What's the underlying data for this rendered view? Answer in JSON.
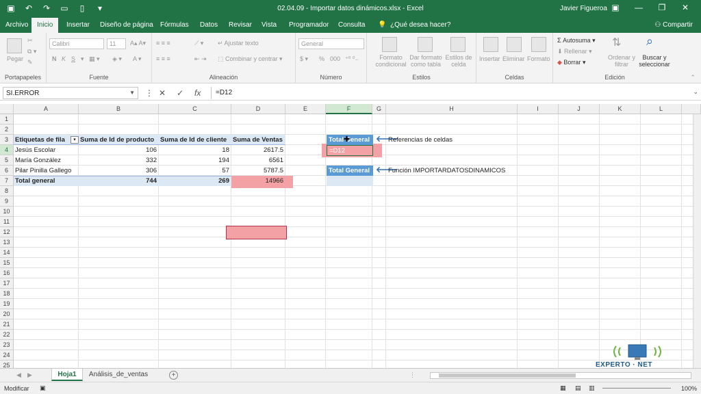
{
  "window": {
    "title": "02.04.09 - Importar datos dinámicos.xlsx - Excel",
    "user": "Javier Figueroa"
  },
  "ribbon_tabs": [
    "Archivo",
    "Inicio",
    "Insertar",
    "Diseño de página",
    "Fórmulas",
    "Datos",
    "Revisar",
    "Vista",
    "Programador",
    "Consulta",
    "¿Qué desea hacer?"
  ],
  "share_label": "Compartir",
  "ribbon": {
    "clipboard": {
      "paste": "Pegar",
      "label": "Portapapeles"
    },
    "font": {
      "name": "Calibri",
      "size": "11",
      "label": "Fuente",
      "bold": "N",
      "italic": "K",
      "underline": "S"
    },
    "alignment": {
      "wrap": "Ajustar texto",
      "merge": "Combinar y centrar",
      "label": "Alineación"
    },
    "number": {
      "format": "General",
      "percent": "%",
      "thousands": "000",
      "label": "Número"
    },
    "styles": {
      "conditional": [
        "Formato",
        "condicional"
      ],
      "as_table": [
        "Dar formato",
        "como tabla"
      ],
      "cell_styles": [
        "Estilos de",
        "celda"
      ],
      "label": "Estilos"
    },
    "cells": {
      "insert": "Insertar",
      "delete": "Eliminar",
      "format": "Formato",
      "label": "Celdas"
    },
    "editing": {
      "autosum": "Autosuma",
      "fill": "Rellenar",
      "clear": "Borrar",
      "sort": [
        "Ordenar y",
        "filtrar"
      ],
      "find": [
        "Buscar y",
        "seleccionar"
      ],
      "label": "Edición"
    }
  },
  "formula_bar": {
    "name_box": "SI.ERROR",
    "formula": "=D12"
  },
  "columns": [
    "A",
    "B",
    "C",
    "D",
    "E",
    "F",
    "G",
    "H",
    "I",
    "J",
    "K",
    "L"
  ],
  "rows": [
    "1",
    "2",
    "3",
    "4",
    "5",
    "6",
    "7",
    "8",
    "9",
    "10",
    "11",
    "12",
    "13",
    "14",
    "15",
    "16",
    "17",
    "18",
    "19",
    "20",
    "21",
    "22",
    "23",
    "24",
    "25"
  ],
  "pivot": {
    "headers": [
      "Etiquetas de fila",
      "Suma de Id de producto",
      "Suma de Id de cliente",
      "Suma de Ventas"
    ],
    "rows": [
      [
        "Jesús Escolar",
        "106",
        "18",
        "2617.5"
      ],
      [
        "María González",
        "332",
        "194",
        "6561"
      ],
      [
        "Pilar Pinilla Gallego",
        "306",
        "57",
        "5787.5"
      ]
    ],
    "total": [
      "Total general",
      "744",
      "269",
      "14966"
    ]
  },
  "side_table": {
    "header1": "Total General",
    "edit_value": "=D12",
    "header2": "Total General",
    "note1": "Referencias de celdas",
    "note2": "Función IMPORTARDATOSDINAMICOS"
  },
  "sheets": [
    "Hoja1",
    "Análisis_de_ventas"
  ],
  "status": {
    "mode": "Modificar",
    "zoom": "100%"
  },
  "watermark": {
    "text": "EXPERTO",
    "suffix": "NET"
  },
  "colors": {
    "excel_green": "#217346",
    "pivot_blue": "#5b9bd5",
    "highlight_red": "#f3a1a4"
  }
}
